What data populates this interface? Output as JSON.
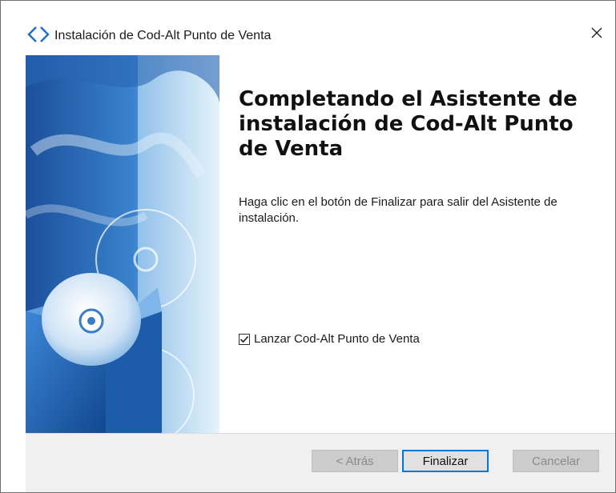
{
  "window": {
    "title": "Instalación de Cod-Alt Punto de Venta",
    "icon": "diamond-brackets-icon",
    "close_icon": "close-icon"
  },
  "banner": {
    "image": "setup-wizard-cd-box-artwork",
    "colors": {
      "dark_blue": "#1f5aa8",
      "light_blue": "#cfe6f7"
    }
  },
  "content": {
    "heading": "Completando el Asistente de instalación de Cod-Alt Punto de Venta",
    "description": "Haga clic en el botón de Finalizar para salir del Asistente de instalación.",
    "launch_checkbox": {
      "label": "Lanzar Cod-Alt Punto de Venta",
      "checked": true
    }
  },
  "footer": {
    "back_label": "< Atrás",
    "finish_label": "Finalizar",
    "cancel_label": "Cancelar"
  },
  "colors": {
    "accent": "#0078d7",
    "footer_bg": "#f0f0f0"
  }
}
